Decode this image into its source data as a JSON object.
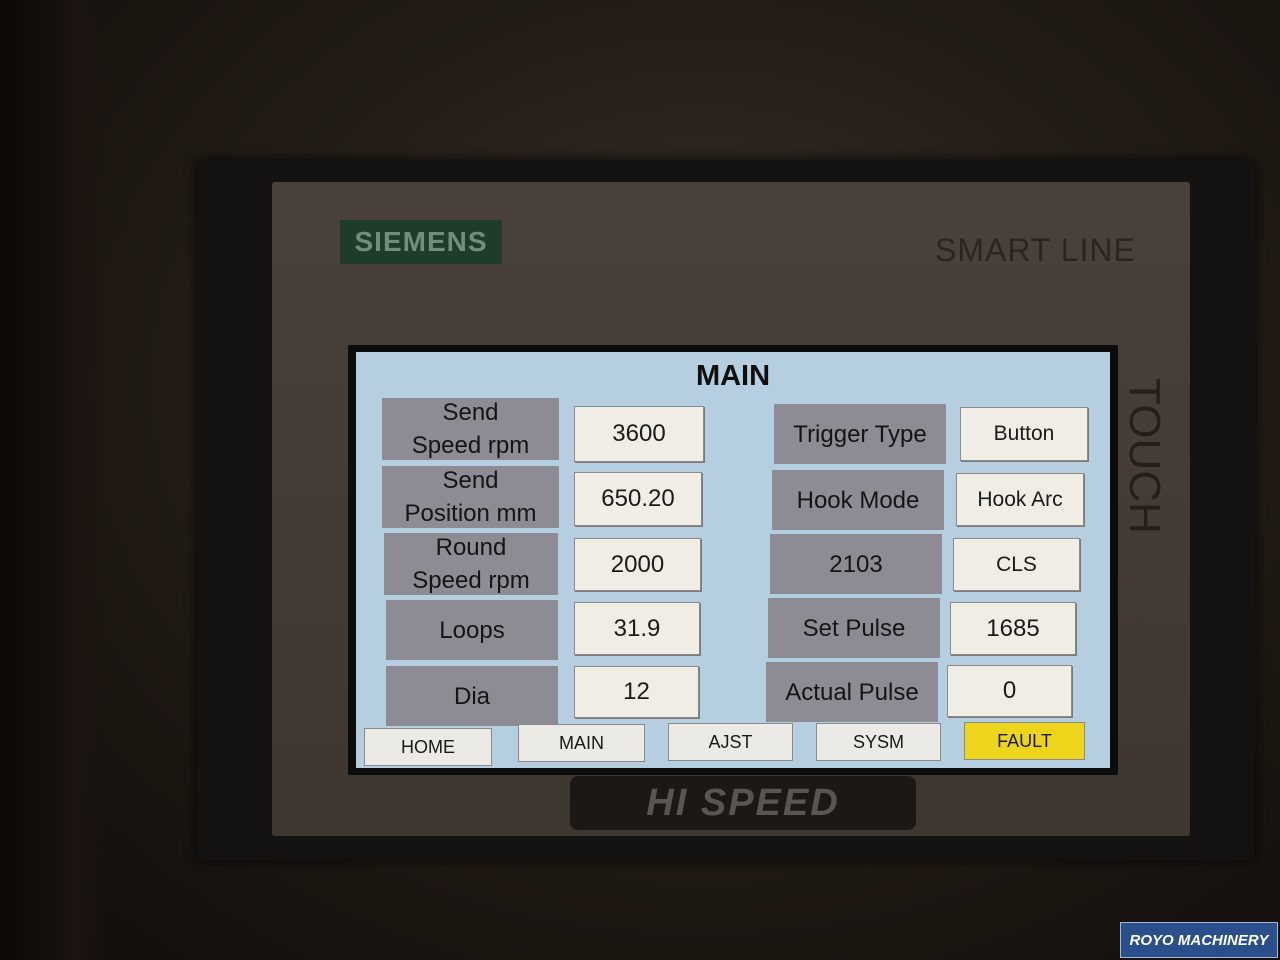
{
  "device": {
    "brand": "SIEMENS",
    "series": "SMART LINE",
    "touch": "TOUCH",
    "bottom_logo": "HI SPEED"
  },
  "screen": {
    "title": "MAIN",
    "left_rows": [
      {
        "label_line1": "Send",
        "label_line2": "Speed rpm",
        "value": "3600"
      },
      {
        "label_line1": "Send",
        "label_line2": "Position mm",
        "value": "650.20"
      },
      {
        "label_line1": "Round",
        "label_line2": "Speed rpm",
        "value": "2000"
      },
      {
        "label_line1": "Loops",
        "label_line2": "",
        "value": "31.9"
      },
      {
        "label_line1": "Dia",
        "label_line2": "",
        "value": "12"
      }
    ],
    "right_rows": [
      {
        "label": "Trigger Type",
        "value": "Button"
      },
      {
        "label": "Hook Mode",
        "value": "Hook Arc"
      },
      {
        "label": "2103",
        "value": "CLS"
      },
      {
        "label": "Set Pulse",
        "value": "1685"
      },
      {
        "label": "Actual Pulse",
        "value": "0"
      }
    ]
  },
  "nav": {
    "home": "HOME",
    "main": "MAIN",
    "ajst": "AJST",
    "sysm": "SYSM",
    "fault": "FAULT"
  },
  "watermark": "ROYO MACHINERY",
  "colors": {
    "screen_bg": "#b6cfe0",
    "label_bg": "#8d8b93",
    "value_bg": "#efede4",
    "fault_bg": "#ecd51a"
  }
}
